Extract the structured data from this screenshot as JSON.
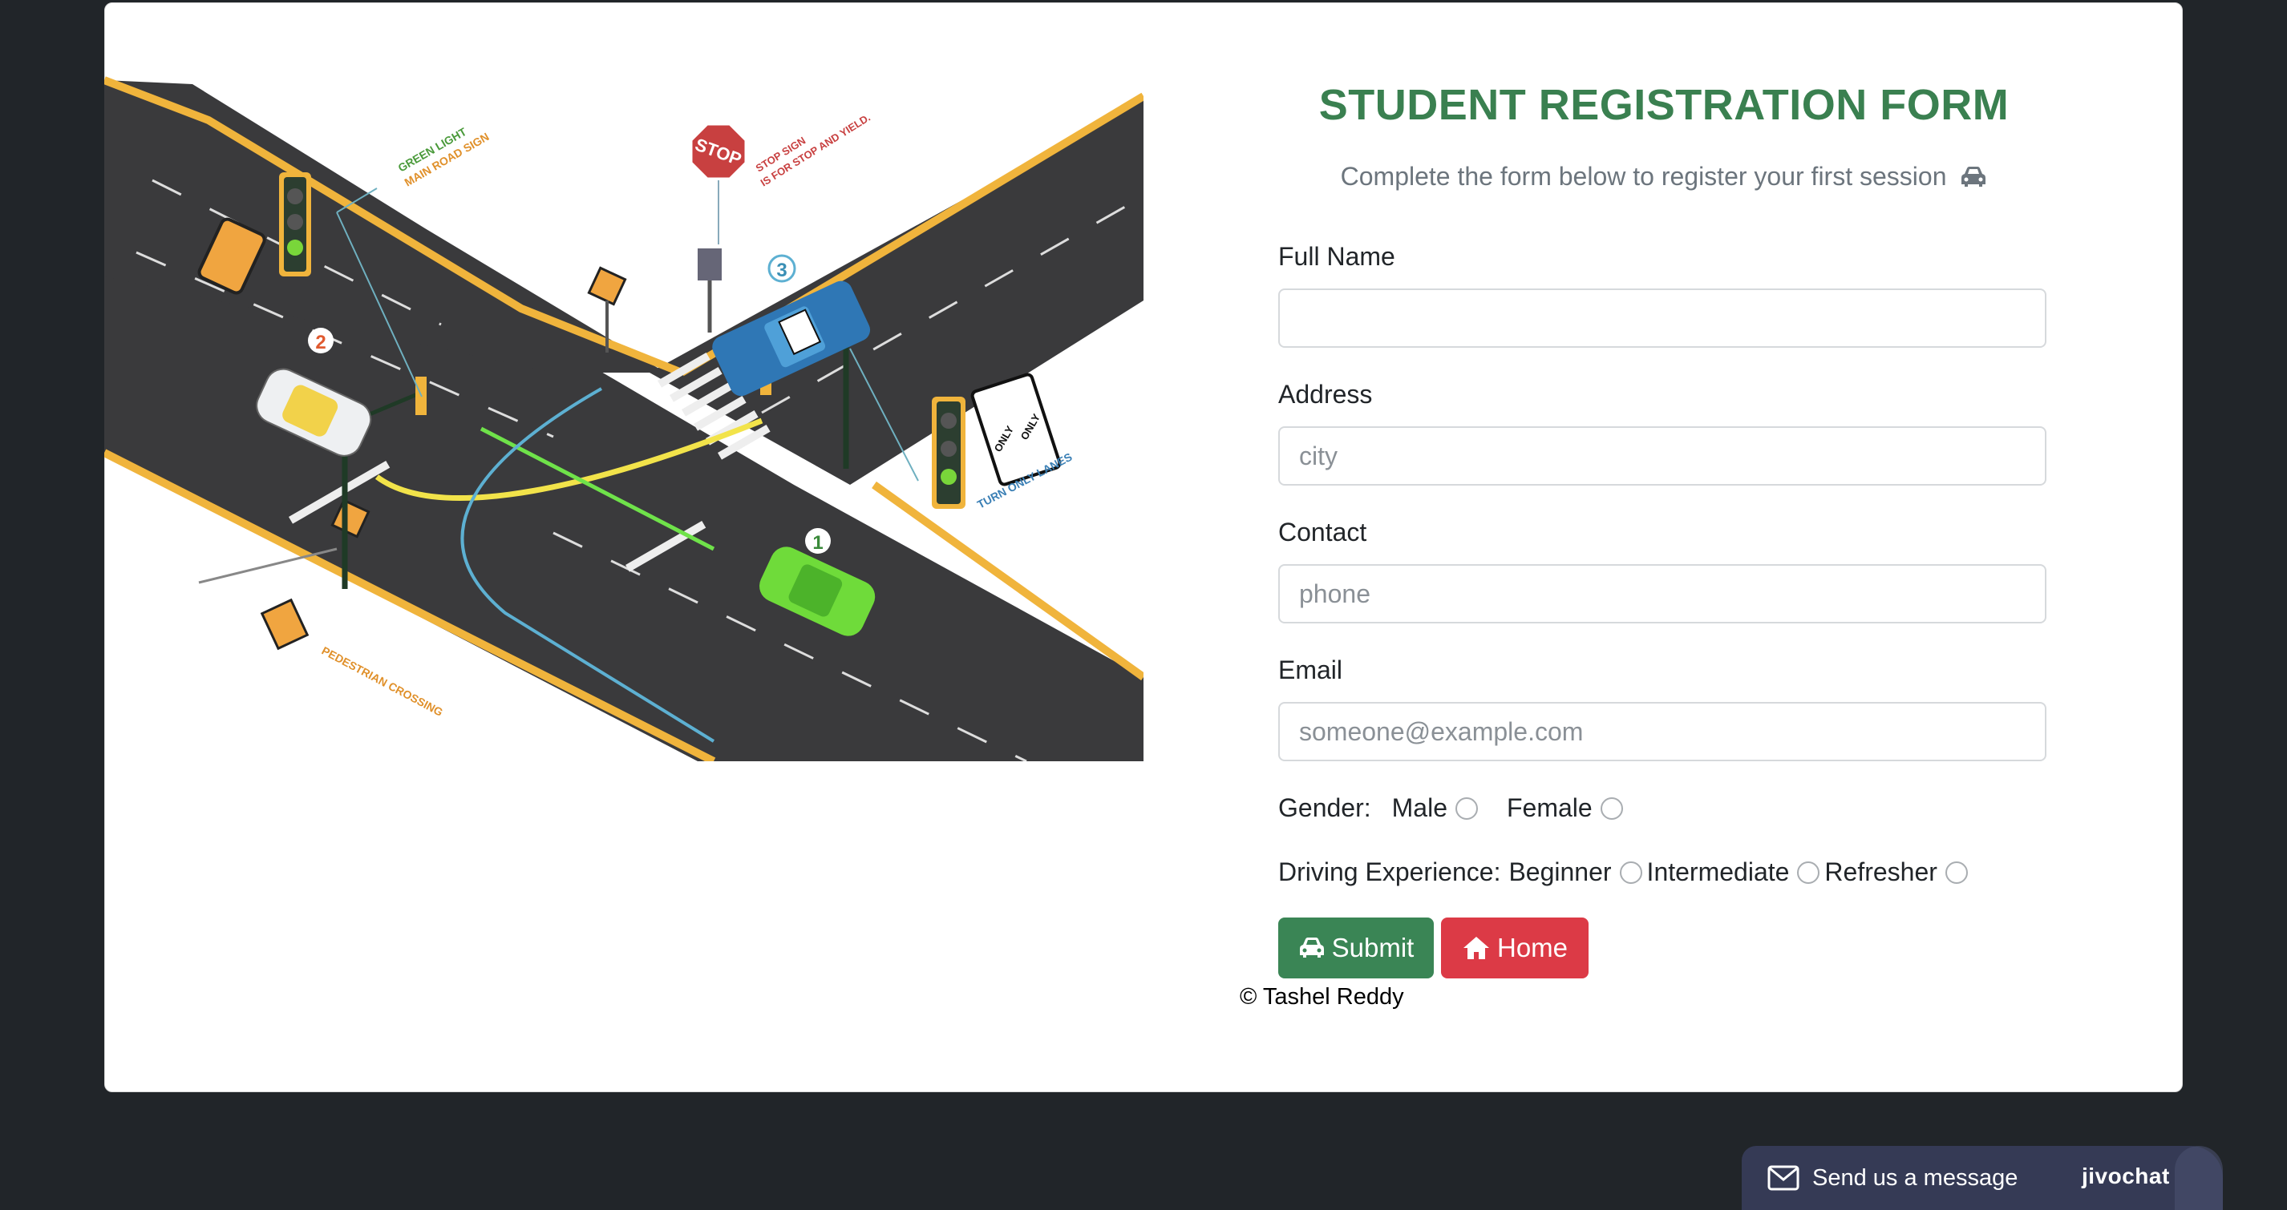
{
  "form": {
    "title": "STUDENT REGISTRATION FORM",
    "subtitle": "Complete the form below to register your first session",
    "fields": {
      "full_name": {
        "label": "Full Name",
        "placeholder": ""
      },
      "address": {
        "label": "Address",
        "placeholder": "city"
      },
      "contact": {
        "label": "Contact",
        "placeholder": "phone"
      },
      "email": {
        "label": "Email",
        "placeholder": "someone@example.com"
      }
    },
    "gender": {
      "label": "Gender:",
      "options": [
        "Male",
        "Female"
      ]
    },
    "experience": {
      "label": "Driving Experience:",
      "options": [
        "Beginner",
        "Intermediate",
        "Refresher"
      ]
    },
    "submit_label": "Submit",
    "home_label": "Home",
    "footer": "© Tashel Reddy"
  },
  "illustration": {
    "labels": {
      "green_light_1": "GREEN LIGHT",
      "green_light_2": "MAIN ROAD SIGN",
      "stop_text": "STOP",
      "stop_sign_1": "STOP SIGN",
      "stop_sign_2": "IS FOR STOP AND YIELD.",
      "turn_lanes": "TURN ONLY LANES",
      "only": "ONLY",
      "pedestrian": "PEDESTRIAN CROSSING",
      "marker_1": "1",
      "marker_2": "2",
      "marker_3": "3"
    }
  },
  "chat": {
    "message": "Send us a message",
    "brand": "jivochat"
  },
  "colors": {
    "accent_green": "#3a8050",
    "submit_bg": "#3a8555",
    "home_bg": "#dc3a46",
    "page_bg": "#212529"
  }
}
